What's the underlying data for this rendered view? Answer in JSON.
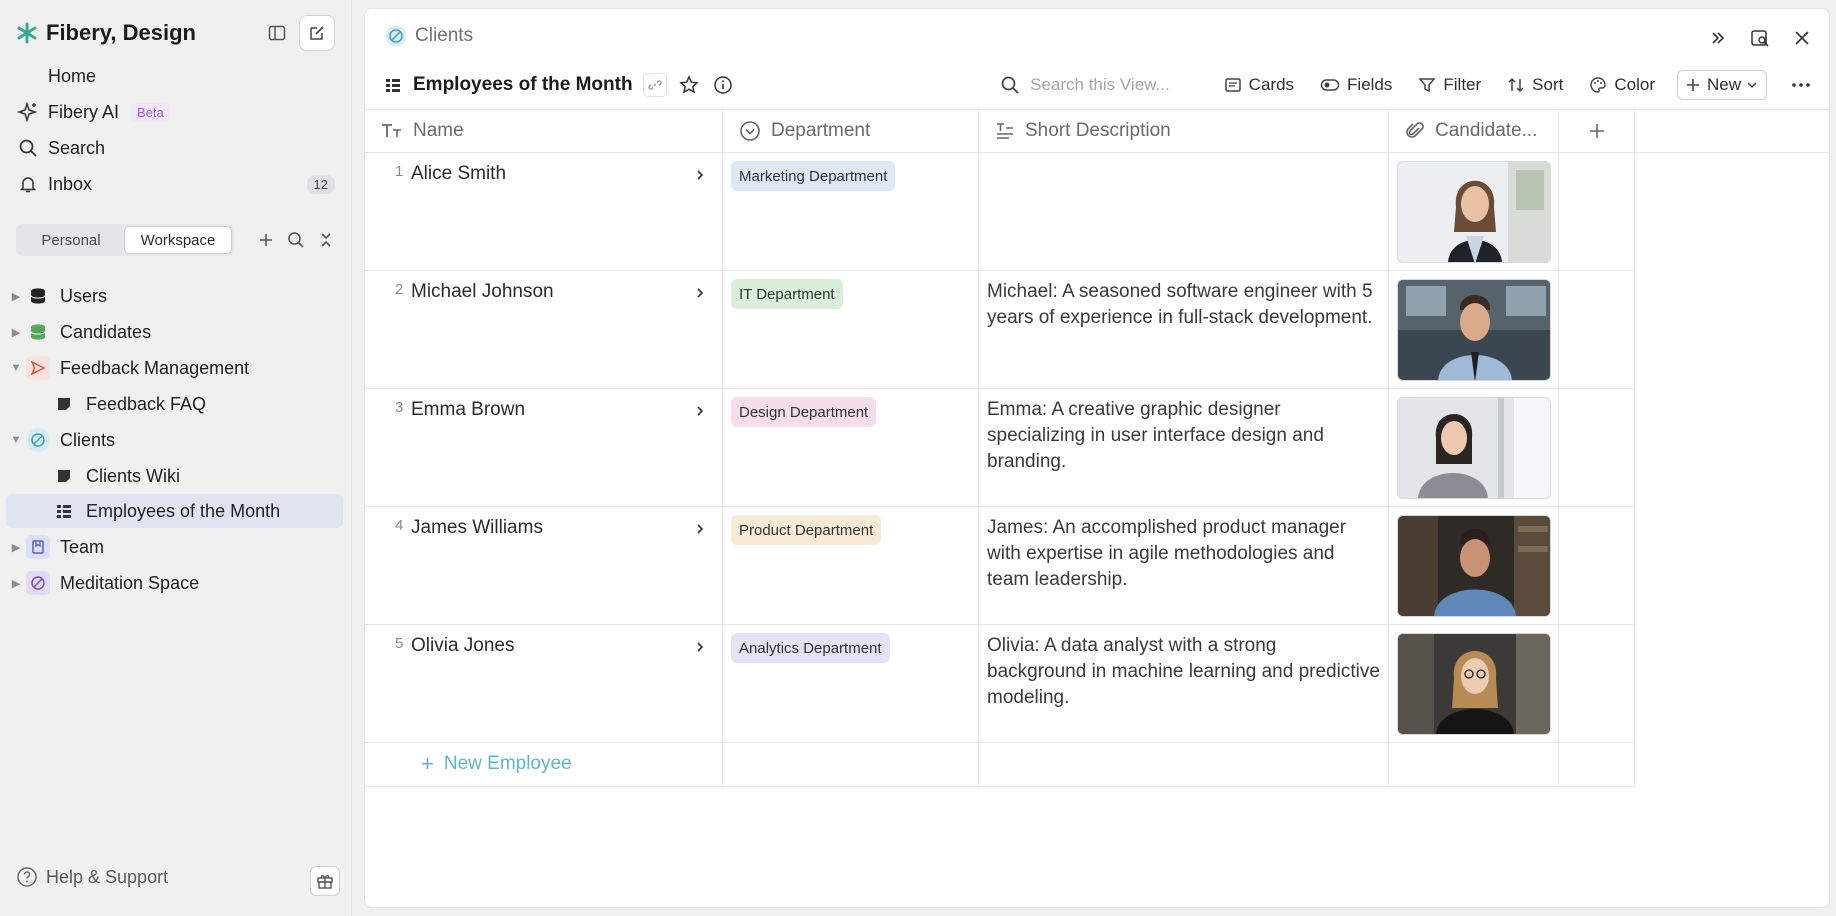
{
  "workspace": {
    "name": "Fibery, Design"
  },
  "nav": {
    "home": "Home",
    "ai": "Fibery AI",
    "ai_badge": "Beta",
    "search": "Search",
    "inbox": "Inbox",
    "inbox_count": "12"
  },
  "segmented": {
    "personal": "Personal",
    "workspace": "Workspace"
  },
  "tree": [
    {
      "label": "Users"
    },
    {
      "label": "Candidates"
    },
    {
      "label": "Feedback Management"
    },
    {
      "label": "Feedback FAQ"
    },
    {
      "label": "Clients"
    },
    {
      "label": "Clients Wiki"
    },
    {
      "label": "Employees of the Month"
    },
    {
      "label": "Team"
    },
    {
      "label": "Meditation Space"
    }
  ],
  "footer": {
    "help": "Help & Support"
  },
  "breadcrumb": {
    "space": "Clients"
  },
  "view": {
    "title": "Employees of the Month",
    "search_placeholder": "Search this View...",
    "tools": {
      "cards": "Cards",
      "fields": "Fields",
      "filter": "Filter",
      "sort": "Sort",
      "color": "Color",
      "new": "New"
    }
  },
  "table": {
    "columns": {
      "name": "Name",
      "department": "Department",
      "description": "Short Description",
      "candidate": "Candidate..."
    },
    "rows": [
      {
        "num": "1",
        "name": "Alice Smith",
        "department": "Marketing Department",
        "dept_color": "#dde8f7",
        "description": ""
      },
      {
        "num": "2",
        "name": "Michael Johnson",
        "department": "IT Department",
        "dept_color": "#d8efdc",
        "description": "Michael: A seasoned software engineer with 5 years of experience in full-stack development."
      },
      {
        "num": "3",
        "name": "Emma Brown",
        "department": "Design Department",
        "dept_color": "#f7dcec",
        "description": "Emma: A creative graphic designer specializing in user interface design and branding."
      },
      {
        "num": "4",
        "name": "James Williams",
        "department": "Product Department",
        "dept_color": "#f8ead6",
        "description": "James: An accomplished product manager with expertise in agile methodologies and team leadership."
      },
      {
        "num": "5",
        "name": "Olivia Jones",
        "department": "Analytics Department",
        "dept_color": "#e6e2f6",
        "description": "Olivia: A data analyst with a strong background in machine learning and predictive modeling."
      }
    ],
    "new_row": "New Employee"
  }
}
